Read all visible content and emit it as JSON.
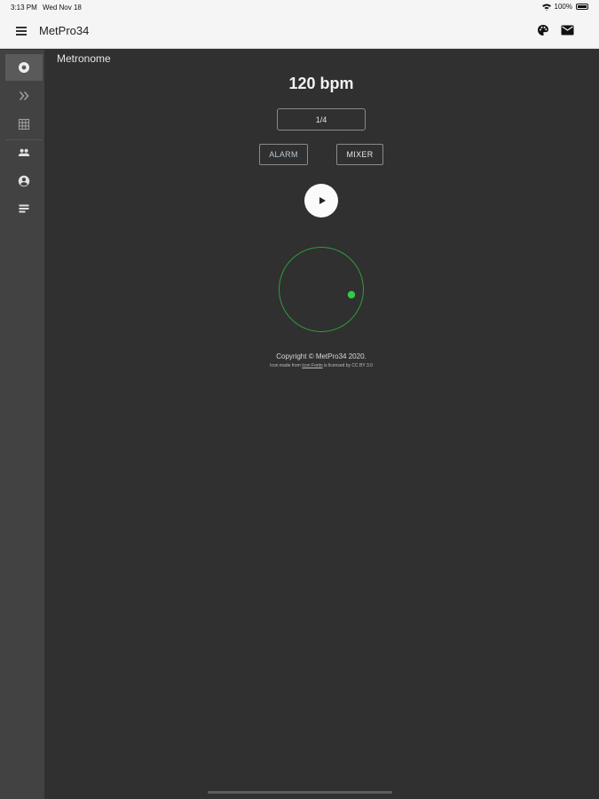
{
  "status_bar": {
    "time": "3:13 PM",
    "date": "Wed Nov 18",
    "battery": "100%"
  },
  "app_bar": {
    "title": "MetPro34"
  },
  "sidebar": {
    "items": [
      {
        "name": "metronome",
        "icon": "record-icon",
        "active": true
      },
      {
        "name": "forward",
        "icon": "double-chevron-right-icon",
        "active": false
      },
      {
        "name": "grid",
        "icon": "grid-icon",
        "active": false
      },
      {
        "name": "people",
        "icon": "people-icon",
        "active": false
      },
      {
        "name": "account",
        "icon": "account-circle-icon",
        "active": false
      },
      {
        "name": "notes",
        "icon": "notes-icon",
        "active": false
      }
    ]
  },
  "main": {
    "heading": "Metronome",
    "bpm": "120 bpm",
    "time_signature": "1/4",
    "alarm_label": "ALARM",
    "mixer_label": "MIXER",
    "copyright": "Copyright © MetPro34 2020.",
    "attribution_prefix": "Icon made from ",
    "attribution_link": "Icon Fonts",
    "attribution_suffix": " is licensed by CC BY 3.0"
  },
  "colors": {
    "background": "#303030",
    "sidebar": "#424242",
    "app_bar": "#f5f5f5",
    "beat_ring": "#2e9e3a",
    "beat_dot": "#2ecc40"
  }
}
